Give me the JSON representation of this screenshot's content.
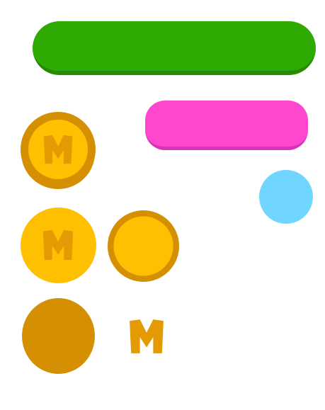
{
  "sprites": {
    "green_bar": {
      "color": "#2eaa02",
      "shadow": "#278a03"
    },
    "pink_bar": {
      "color": "#ff46cf",
      "shadow": "#d832b8"
    },
    "blue_circle": {
      "color": "#70d6ff"
    },
    "coin": {
      "face_color": "#ffc002",
      "rim_color": "#d49002",
      "emblem_color": "#e49a02",
      "emblem_letter": "M"
    }
  }
}
